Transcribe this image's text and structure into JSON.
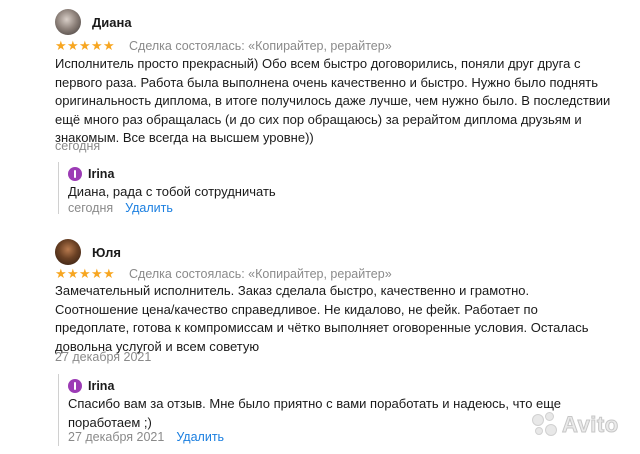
{
  "reviews": [
    {
      "author": "Диана",
      "rating": 5,
      "deal": "Сделка состоялась: «Копирайтер, рерайтер»",
      "text": "Исполнитель просто прекрасный) Обо всем быстро договорились, поняли друг друга с первого раза. Работа была выполнена очень качественно и быстро. Нужно было поднять оригинальность диплома, в итоге получилось даже лучше, чем нужно было. В последствии ещё много раз обращалась (и до сих пор обращаюсь) за рерайтом диплома друзьям и знакомым. Все всегда на высшем уровне))",
      "date": "сегодня",
      "reply": {
        "author": "Irina",
        "text": "Диана, рада с тобой сотрудничать",
        "date": "сегодня",
        "delete_label": "Удалить"
      }
    },
    {
      "author": "Юля",
      "rating": 5,
      "deal": "Сделка состоялась: «Копирайтер, рерайтер»",
      "text": "Замечательный исполнитель. Заказ сделала быстро, качественно и грамотно. Соотношение цена/качество справедливое. Не кидалово, не фейк. Работает по предоплате, готова к компромиссам и чётко выполняет оговоренные условия. Осталась довольна услугой и всем советую",
      "date": "27 декабря 2021",
      "reply": {
        "author": "Irina",
        "text": "Спасибо вам за отзыв. Мне было приятно с вами поработать и надеюсь, что еще поработаем ;)",
        "date": "27 декабря 2021",
        "delete_label": "Удалить"
      }
    }
  ],
  "star_glyph": "★",
  "star_color": "#f7a621",
  "link_color": "#1b7fe0",
  "reply_icon_color": "#9c3bb5",
  "watermark": "Avito"
}
